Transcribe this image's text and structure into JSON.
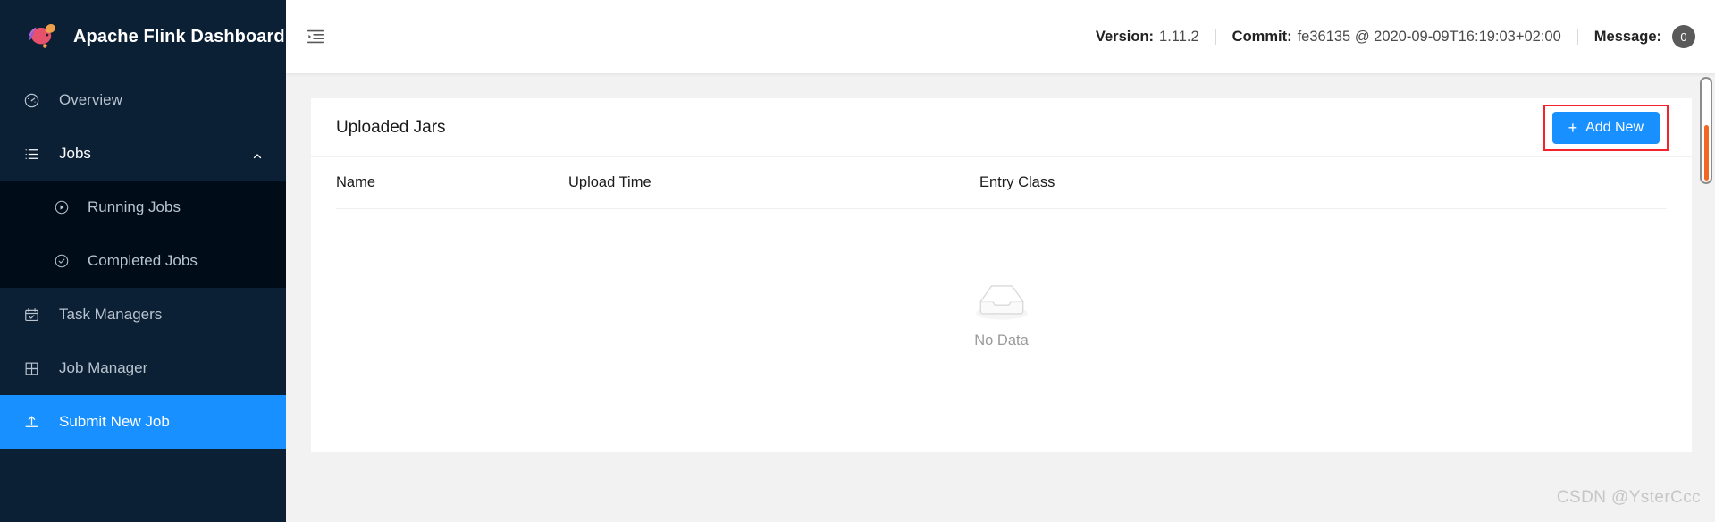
{
  "sidebar": {
    "brand": {
      "title": "Apache Flink Dashboard",
      "logo_icon": "flink-squirrel-logo"
    },
    "items": [
      {
        "label": "Overview",
        "icon": "dashboard-gauge-icon",
        "selected": false,
        "type": "item"
      },
      {
        "label": "Jobs",
        "icon": "list-icon",
        "selected": false,
        "type": "parent",
        "expanded": true,
        "chevron_icon": "chevron-up-icon"
      },
      {
        "label": "Running Jobs",
        "icon": "play-circle-icon",
        "selected": false,
        "type": "sub"
      },
      {
        "label": "Completed Jobs",
        "icon": "check-circle-icon",
        "selected": false,
        "type": "sub"
      },
      {
        "label": "Task Managers",
        "icon": "calendar-check-icon",
        "selected": false,
        "type": "item"
      },
      {
        "label": "Job Manager",
        "icon": "grid-block-icon",
        "selected": false,
        "type": "item"
      },
      {
        "label": "Submit New Job",
        "icon": "upload-icon",
        "selected": true,
        "type": "item"
      }
    ]
  },
  "topbar": {
    "fold_icon": "menu-fold-icon",
    "version_label": "Version:",
    "version_value": "1.11.2",
    "commit_label": "Commit:",
    "commit_value": "fe36135 @ 2020-09-09T16:19:03+02:00",
    "message_label": "Message:",
    "message_count": "0"
  },
  "card": {
    "title": "Uploaded Jars",
    "add_new_label": "Add New",
    "add_new_plus_icon": "plus-icon",
    "highlight_color": "#f5222d",
    "accent_color": "#1890ff",
    "columns": [
      "Name",
      "Upload Time",
      "Entry Class"
    ],
    "rows": [],
    "empty": {
      "icon": "empty-inbox-icon",
      "text": "No Data"
    }
  },
  "watermark": {
    "text": "CSDN @YsterCcc"
  },
  "scrollbar": {
    "thumb_color": "#f26722"
  }
}
